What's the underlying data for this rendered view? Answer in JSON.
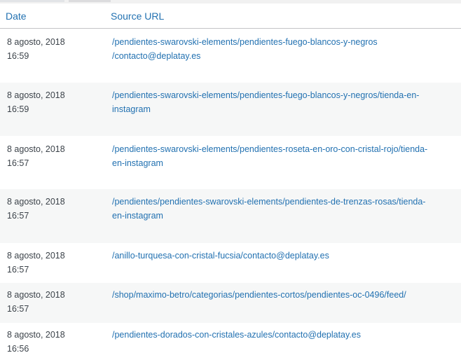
{
  "table": {
    "headers": {
      "date": "Date",
      "source_url": "Source URL"
    },
    "rows": [
      {
        "date": "8 agosto, 2018",
        "time": "16:59",
        "url_line1": "/pendientes-swarovski-elements/pendientes-fuego-blancos-y-negros",
        "url_line2": "/contacto@deplatay.es"
      },
      {
        "date": "8 agosto, 2018",
        "time": "16:59",
        "url_line1": "/pendientes-swarovski-elements/pendientes-fuego-blancos-y-negros/tienda-en-",
        "url_line2": "instagram"
      },
      {
        "date": "8 agosto, 2018",
        "time": "16:57",
        "url_line1": "/pendientes-swarovski-elements/pendientes-roseta-en-oro-con-cristal-rojo/tienda-",
        "url_line2": "en-instagram"
      },
      {
        "date": "8 agosto, 2018",
        "time": "16:57",
        "url_line1": "/pendientes/pendientes-swarovski-elements/pendientes-de-trenzas-rosas/tienda-",
        "url_line2": "en-instagram"
      },
      {
        "date": "8 agosto, 2018",
        "time": "16:57",
        "url_line1": "/anillo-turquesa-con-cristal-fucsia/contacto@deplatay.es",
        "url_line2": ""
      },
      {
        "date": "8 agosto, 2018",
        "time": "16:57",
        "url_line1": "/shop/maximo-betro/categorias/pendientes-cortos/pendientes-oc-0496/feed/",
        "url_line2": ""
      },
      {
        "date": "8 agosto, 2018",
        "time": "16:56",
        "url_line1": "/pendientes-dorados-con-cristales-azules/contacto@deplatay.es",
        "url_line2": ""
      }
    ]
  },
  "colors": {
    "link": "#2271b1",
    "text": "#3c434a",
    "alt_row": "#f6f7f7",
    "border": "#c3c4c7"
  }
}
